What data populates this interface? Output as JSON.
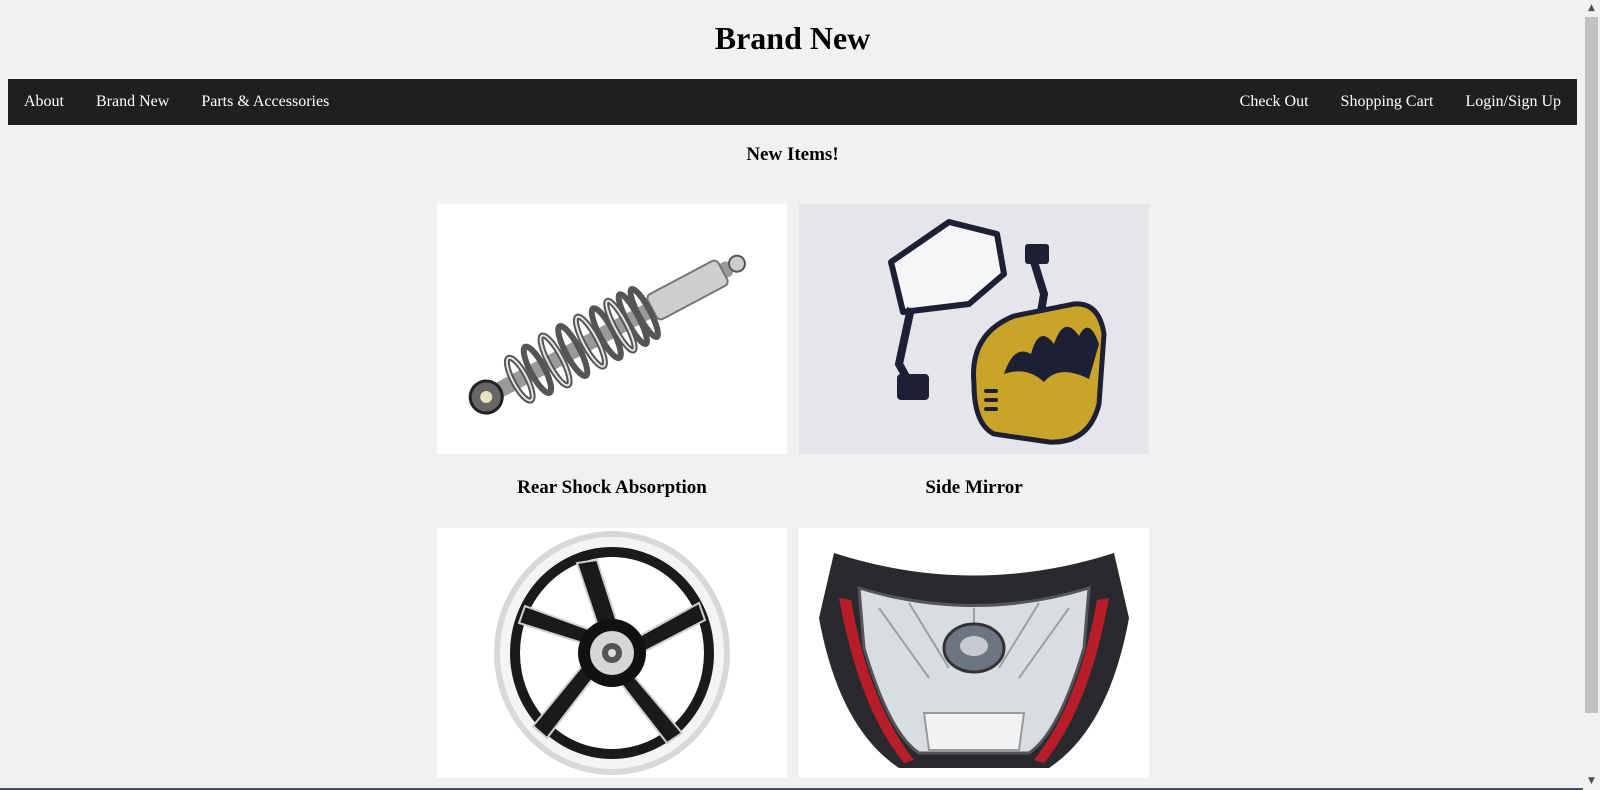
{
  "site": {
    "title": "Brand New"
  },
  "nav": {
    "left": [
      "About",
      "Brand New",
      "Parts & Accessories"
    ],
    "right": [
      "Check Out",
      "Shopping Cart",
      "Login/Sign Up"
    ]
  },
  "main": {
    "heading": "New Items!",
    "products": [
      {
        "name": "Rear Shock Absorption",
        "image": "rear-shock-absorber-image"
      },
      {
        "name": "Side Mirror",
        "image": "side-mirror-image"
      },
      {
        "name": "",
        "image": "motorcycle-wheel-image"
      },
      {
        "name": "",
        "image": "headlight-image"
      }
    ]
  },
  "colors": {
    "background": "#f1f1f1",
    "navbar": "#1f1f1f",
    "nav_text": "#ffffff"
  }
}
